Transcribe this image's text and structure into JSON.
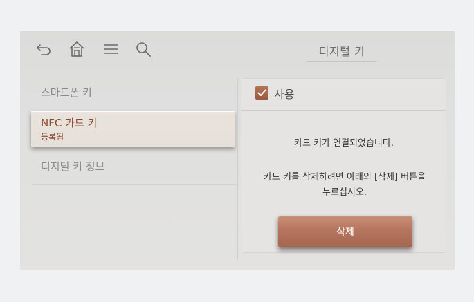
{
  "header": {
    "title": "디지털 키",
    "icons": [
      "back-icon",
      "home-icon",
      "menu-icon",
      "search-icon"
    ]
  },
  "sidebar": {
    "items": [
      {
        "label": "스마트폰 키"
      },
      {
        "label": "NFC 카드 키",
        "sublabel": "등록됨",
        "selected": true
      },
      {
        "label": "디지털 키 정보"
      }
    ]
  },
  "detail": {
    "use_label": "사용",
    "use_checked": true,
    "message_connected": "카드 키가 연결되었습니다.",
    "message_delete_line1": "카드 키를 삭제하려면 아래의 [삭제] 버튼을",
    "message_delete_line2": "누르십시오.",
    "delete_button": "삭제"
  },
  "colors": {
    "accent": "#b06d55",
    "selected_text": "#8c4a30"
  }
}
